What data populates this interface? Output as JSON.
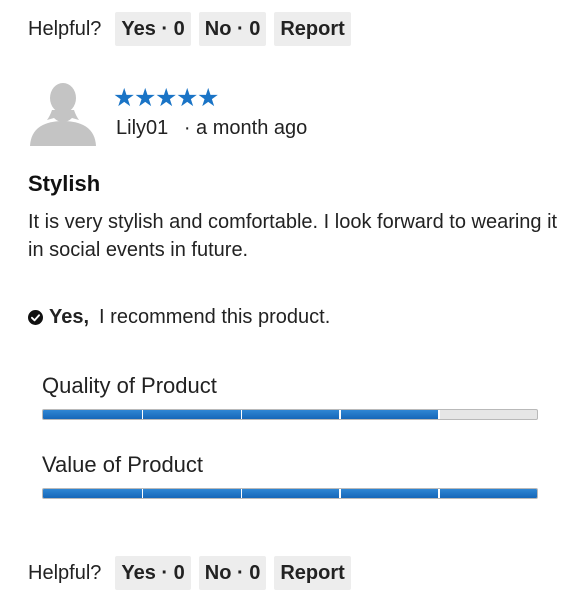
{
  "helpful_top": {
    "label": "Helpful?",
    "yes": "Yes · 0",
    "no": "No · 0",
    "report": "Report"
  },
  "review": {
    "rating": 5,
    "stars": "★★★★★",
    "star_color": "#1a74c6",
    "author": "Lily01",
    "time": "· a month ago",
    "title": "Stylish",
    "body": "It is very stylish and comfortable. I look forward to wearing it in social events in future.",
    "recommend": {
      "yes": "Yes,",
      "text": "I recommend this product."
    },
    "ratings": [
      {
        "label": "Quality of Product",
        "value": 4,
        "max": 5
      },
      {
        "label": "Value of Product",
        "value": 5,
        "max": 5
      }
    ]
  },
  "helpful_bottom": {
    "label": "Helpful?",
    "yes": "Yes · 0",
    "no": "No · 0",
    "report": "Report"
  },
  "icons": {
    "avatar": "user-silhouette",
    "check": "check-circle"
  },
  "colors": {
    "accent": "#1a74c6",
    "bar_empty": "#e6e6e6",
    "pill_bg": "#ededed"
  }
}
